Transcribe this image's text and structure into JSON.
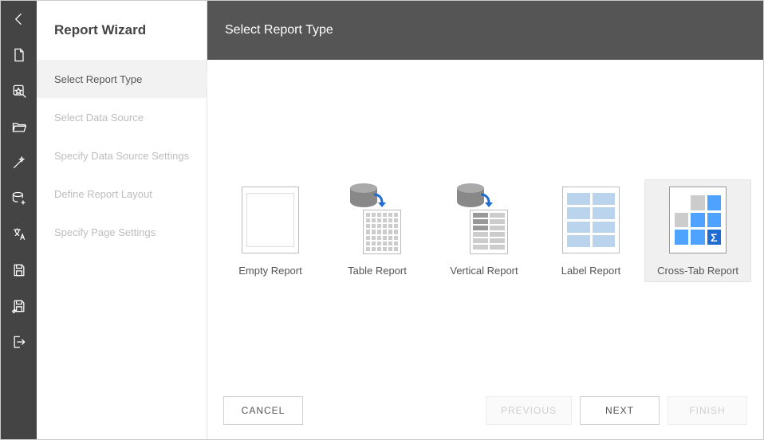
{
  "sidebar": {
    "title": "Report Wizard",
    "steps": [
      {
        "label": "Select Report Type",
        "active": true
      },
      {
        "label": "Select Data Source",
        "active": false
      },
      {
        "label": "Specify Data Source Settings",
        "active": false
      },
      {
        "label": "Define Report Layout",
        "active": false
      },
      {
        "label": "Specify Page Settings",
        "active": false
      }
    ]
  },
  "header": {
    "title": "Select Report Type"
  },
  "report_types": [
    {
      "id": "empty",
      "label": "Empty Report",
      "selected": false
    },
    {
      "id": "table",
      "label": "Table Report",
      "selected": false
    },
    {
      "id": "vertical",
      "label": "Vertical Report",
      "selected": false
    },
    {
      "id": "label",
      "label": "Label Report",
      "selected": false
    },
    {
      "id": "crosstab",
      "label": "Cross-Tab Report",
      "selected": true
    }
  ],
  "footer": {
    "cancel": "CANCEL",
    "previous": "PREVIOUS",
    "next": "NEXT",
    "finish": "FINISH"
  },
  "toolbar_icons": [
    "back",
    "new-file",
    "search-star",
    "open-folder",
    "wizard-wand",
    "database-add",
    "language",
    "save",
    "save-as",
    "exit"
  ]
}
